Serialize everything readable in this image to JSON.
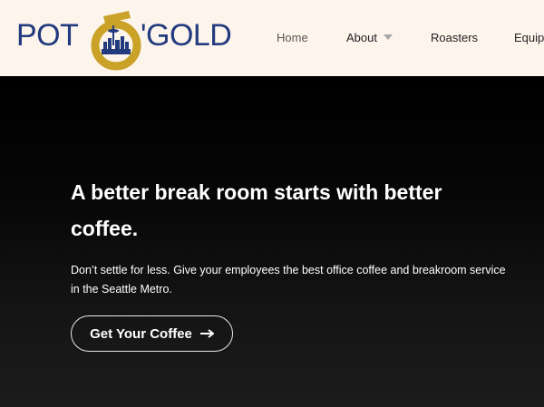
{
  "brand": {
    "logo_left": "POT",
    "logo_right": "'GOLD",
    "colors": {
      "navy": "#223a7e",
      "gold": "#c9a227",
      "header_bg": "#fdf4ec"
    }
  },
  "nav": {
    "items": [
      {
        "label": "Home"
      },
      {
        "label": "About"
      },
      {
        "label": "Roasters"
      },
      {
        "label": "Equip"
      }
    ],
    "about_icon": "chevron-down-icon"
  },
  "hero": {
    "title": "A better break room starts with better coffee.",
    "subtitle": "Don’t settle for less. Give your employees the best office coffee and breakroom service in the Seattle Metro.",
    "cta_label": "Get Your Coffee",
    "cta_icon": "arrow-right-icon"
  }
}
